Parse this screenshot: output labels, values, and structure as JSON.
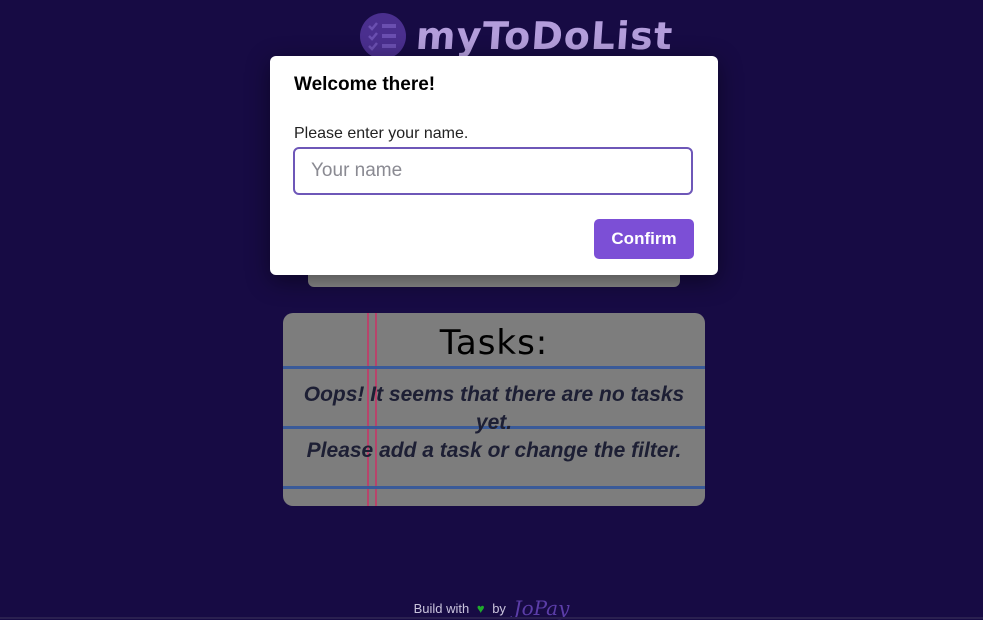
{
  "app": {
    "logo_text": "myToDoList",
    "logo_icon": "checklist-icon"
  },
  "tasks": {
    "title": "Tasks:",
    "empty_line1": "Oops! It seems that there are no tasks yet.",
    "empty_line2": "Please add a task or change the filter."
  },
  "footer": {
    "prefix": "Build with",
    "heart": "♥",
    "by": "by",
    "author": "JoPay"
  },
  "modal": {
    "title": "Welcome there!",
    "label": "Please enter your name.",
    "input_value": "",
    "input_placeholder": "Your name",
    "confirm_label": "Confirm"
  },
  "colors": {
    "background": "#170b44",
    "accent": "#7c4fd6",
    "input_border": "#6e57b8",
    "heart": "#1eaa2c"
  }
}
